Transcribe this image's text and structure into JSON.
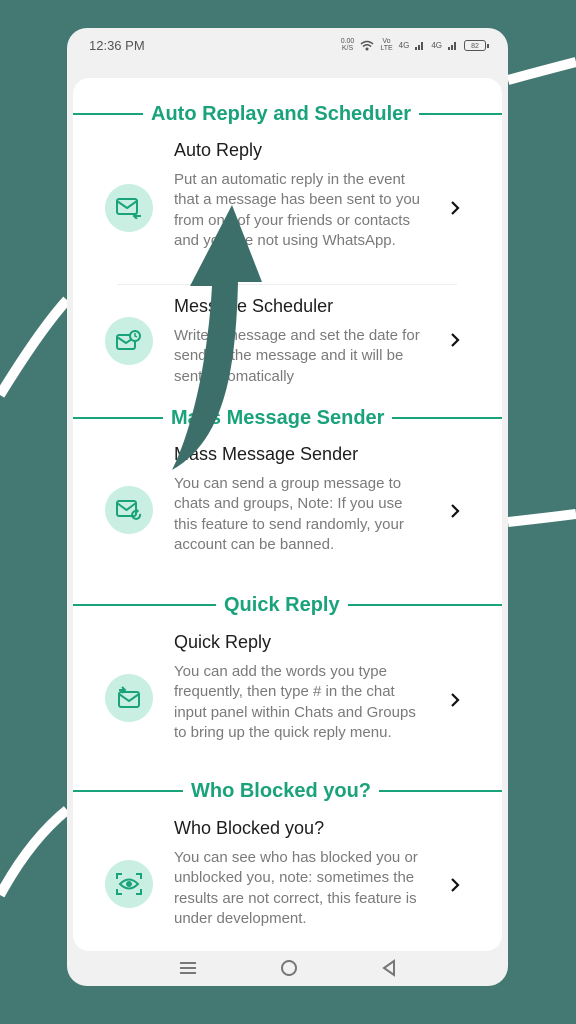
{
  "status_bar": {
    "time": "12:36 PM",
    "speed": "0.00",
    "speed_unit": "K/S",
    "volte": "Vo",
    "lte": "LTE",
    "network1": "4G",
    "network2": "4G",
    "battery": "82"
  },
  "sections": [
    {
      "title": "Auto Replay and Scheduler",
      "items": [
        {
          "title": "Auto Reply",
          "description": "Put an automatic reply in the event that a message has been sent to you from one of your friends or contacts and you are not using WhatsApp.",
          "icon": "mail-reply-icon"
        },
        {
          "title": "Message Scheduler",
          "description": "Write a message and set the date for sending the message and it will be sent automatically",
          "icon": "mail-clock-icon"
        }
      ]
    },
    {
      "title": "Mass Message Sender",
      "items": [
        {
          "title": "Mass Message Sender",
          "description": "You can send a group message to chats and groups, Note: If you use this feature to send randomly, your account can be banned.",
          "icon": "mail-refresh-icon"
        }
      ]
    },
    {
      "title": "Quick Reply",
      "items": [
        {
          "title": "Quick Reply",
          "description": "You can add the words you type frequently, then type # in the chat input panel within Chats and Groups to bring up the quick reply menu.",
          "icon": "mail-open-icon"
        }
      ]
    },
    {
      "title": "Who Blocked you?",
      "items": [
        {
          "title": "Who Blocked you?",
          "description": "You can see who has blocked you or unblocked you, note: sometimes the results are not correct, this feature is under development.",
          "icon": "eye-scan-icon"
        }
      ]
    }
  ],
  "nav": {
    "menu_icon": "menu-icon",
    "home_icon": "home-circle-icon",
    "back_icon": "back-triangle-icon"
  },
  "colors": {
    "background": "#447872",
    "accent": "#1aa37a",
    "icon_circle": "#c9efe2",
    "overlay_arrow": "#3d6f6a"
  }
}
